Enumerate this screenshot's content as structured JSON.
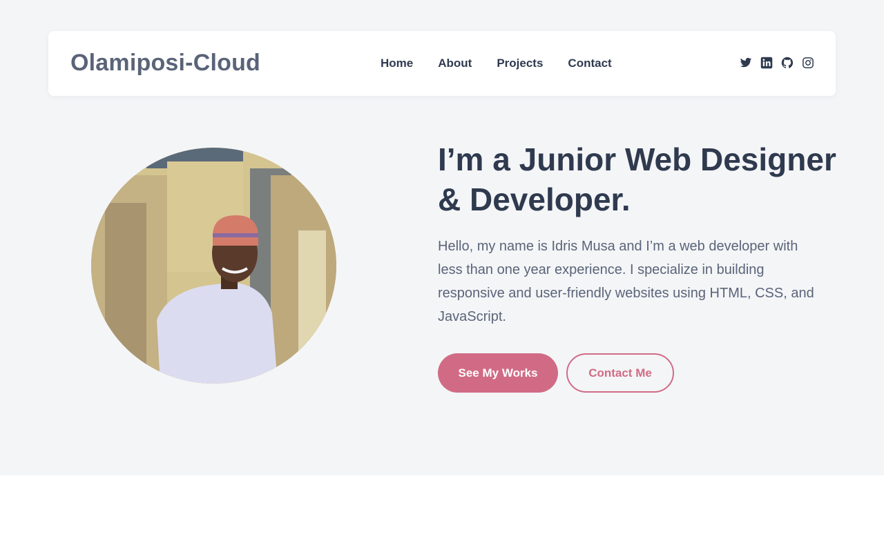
{
  "brand": {
    "name": "Olamiposi-Cloud"
  },
  "nav": {
    "items": [
      {
        "label": "Home"
      },
      {
        "label": "About"
      },
      {
        "label": "Projects"
      },
      {
        "label": "Contact"
      }
    ]
  },
  "socials": [
    {
      "icon": "twitter-icon"
    },
    {
      "icon": "linkedin-icon"
    },
    {
      "icon": "github-icon"
    },
    {
      "icon": "instagram-icon"
    }
  ],
  "hero": {
    "headline": "I’m a Junior Web Designer & Developer.",
    "intro": "Hello, my name is Idris Musa and I’m a web developer with less than one year experience. I specialize in building responsive and user-friendly websites using HTML, CSS, and JavaScript.",
    "primary_button": "See My Works",
    "secondary_button": "Contact Me"
  },
  "colors": {
    "accent": "#d16b85",
    "text_dark": "#2f3a4f",
    "text_muted": "#5a6478",
    "hero_background": "#f4f5f7"
  }
}
